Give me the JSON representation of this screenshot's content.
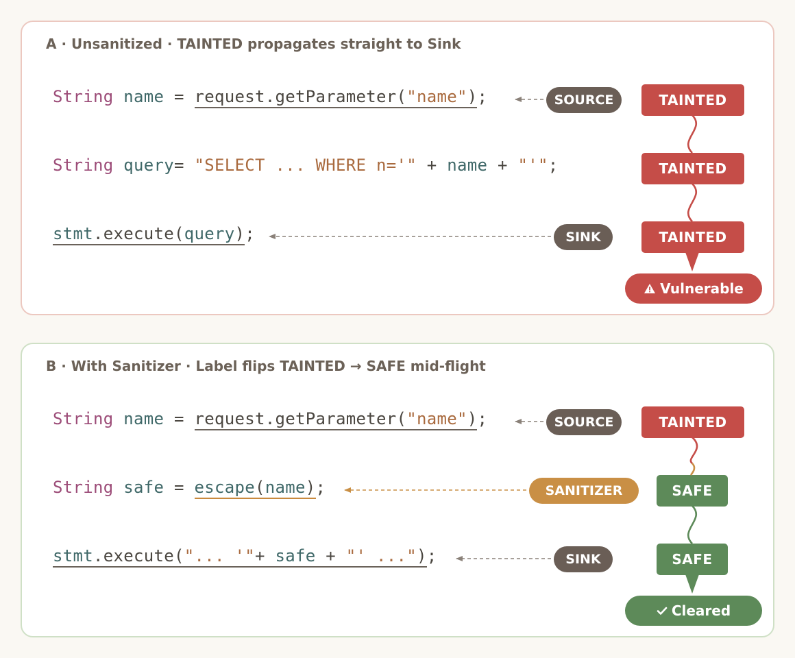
{
  "panel_a": {
    "title": "A · Unsanitized · TAINTED propagates straight to Sink",
    "line1": {
      "kw": "String",
      "var": "name",
      "eq": " = ",
      "call": "request.getParameter(",
      "str": "\"name\"",
      "close": ")",
      "semi": ";"
    },
    "line2": {
      "kw": "String",
      "var": "query",
      "eq": "= ",
      "str1": "\"SELECT ... WHERE n='\"",
      "plus1": " + ",
      "var2": "name",
      "plus2": " + ",
      "str2": "\"'\"",
      "semi": ";"
    },
    "line3": {
      "var": "stmt",
      "call": ".execute(",
      "arg": "query",
      "close": ")",
      "semi": ";"
    },
    "source_label": "SOURCE",
    "sink_label": "SINK",
    "taint_labels": [
      "TAINTED",
      "TAINTED",
      "TAINTED"
    ],
    "result_icon": "warning-icon",
    "result_label": "Vulnerable"
  },
  "panel_b": {
    "title": "B · With Sanitizer · Label flips TAINTED → SAFE mid-flight",
    "line1": {
      "kw": "String",
      "var": "name",
      "eq": " = ",
      "call": "request.getParameter(",
      "str": "\"name\"",
      "close": ")",
      "semi": ";"
    },
    "line2": {
      "kw": "String",
      "var": "safe",
      "eq": " = ",
      "fn": "escape",
      "open": "(",
      "arg": "name",
      "close": ")",
      "semi": ";"
    },
    "line3": {
      "var": "stmt",
      "call": ".execute(",
      "str1": "\"... '\"",
      "plus1": "+ ",
      "var2": "safe",
      "plus2": " + ",
      "str2": "\"' ...\"",
      "close": ")",
      "semi": ";"
    },
    "source_label": "SOURCE",
    "sanitizer_label": "SANITIZER",
    "sink_label": "SINK",
    "labels": [
      "TAINTED",
      "SAFE",
      "SAFE"
    ],
    "result_icon": "check-icon",
    "result_label": "Cleared"
  },
  "colors": {
    "tainted": "#c54d48",
    "safe": "#5d8a59",
    "sanitizer": "#c98f45",
    "neutral_pill": "#6a5e56",
    "panel_a_border": "#ecc8c0",
    "panel_b_border": "#cfe0c6"
  }
}
